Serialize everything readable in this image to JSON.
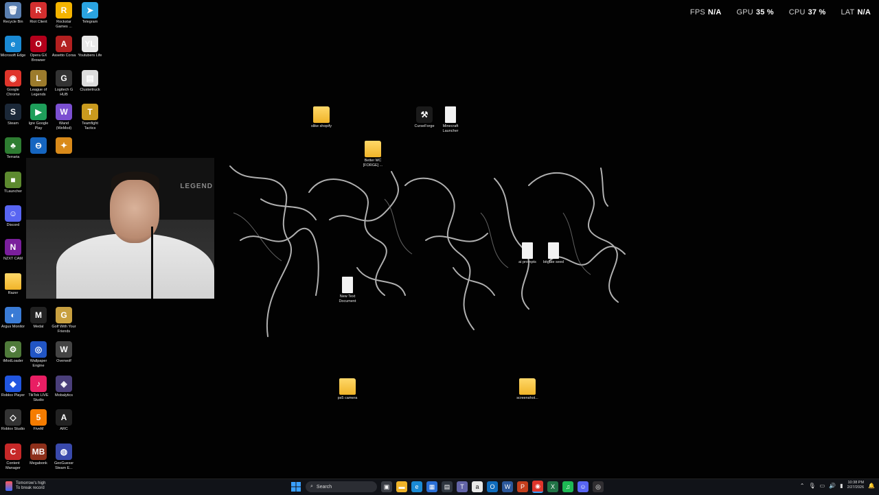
{
  "hud": {
    "fps_label": "FPS",
    "fps_value": "N/A",
    "gpu_label": "GPU",
    "gpu_value": "35 %",
    "cpu_label": "CPU",
    "cpu_value": "37 %",
    "lat_label": "LAT",
    "lat_value": "N/A"
  },
  "desktop_icons": [
    {
      "label": "Recycle Bin",
      "glyph": "🗑",
      "color": "#5a7fb0"
    },
    {
      "label": "Riot Client",
      "glyph": "R",
      "color": "#d32f2f"
    },
    {
      "label": "Rockstar Games ...",
      "glyph": "R",
      "color": "#f5b400"
    },
    {
      "label": "Telegram",
      "glyph": "➤",
      "color": "#2aa3e0"
    },
    {
      "label": "Microsoft Edge",
      "glyph": "e",
      "color": "#1a8ad4"
    },
    {
      "label": "Opera GX Browser",
      "glyph": "O",
      "color": "#b3001b"
    },
    {
      "label": "Assetto Corsa",
      "glyph": "A",
      "color": "#b32020"
    },
    {
      "label": "Youtubers Life",
      "glyph": "YL",
      "color": "#e8e8e8"
    },
    {
      "label": "Google Chrome",
      "glyph": "◉",
      "color": "#e0352b"
    },
    {
      "label": "League of Legends",
      "glyph": "L",
      "color": "#9c7b2c"
    },
    {
      "label": "Logitech G HUB",
      "glyph": "G",
      "color": "#333333"
    },
    {
      "label": "Clustertruck",
      "glyph": "▤",
      "color": "#dddddd"
    },
    {
      "label": "Steam",
      "glyph": "S",
      "color": "#1b2838"
    },
    {
      "label": "Igre Google Play",
      "glyph": "▶",
      "color": "#1e9e5a"
    },
    {
      "label": "Wand (WeMod)",
      "glyph": "W",
      "color": "#7b4fd1"
    },
    {
      "label": "Teamfight Tactics",
      "glyph": "T",
      "color": "#c99a1e"
    },
    {
      "label": "Terraria",
      "glyph": "♣",
      "color": "#2e7d32"
    },
    {
      "label": "",
      "glyph": "⊖",
      "color": "#1565c0"
    },
    {
      "label": "",
      "glyph": "✦",
      "color": "#d98a1a"
    },
    {
      "label": "TLauncher",
      "glyph": "■",
      "color": "#5d8a2f"
    },
    {
      "label": "Discord",
      "glyph": "☺",
      "color": "#5865f2"
    },
    {
      "label": "NZXT CAM",
      "glyph": "N",
      "color": "#7a1f9c"
    },
    {
      "label": "Razer",
      "glyph": "",
      "color": "#f0b429"
    },
    {
      "label": "Argus Monitor",
      "glyph": "◐",
      "color": "#3a7bd5"
    },
    {
      "label": "Medal",
      "glyph": "M",
      "color": "#222222"
    },
    {
      "label": "Golf With Your Friends",
      "glyph": "G",
      "color": "#c8a040"
    },
    {
      "label": "tModLoader",
      "glyph": "⚙",
      "color": "#4f7a3a"
    },
    {
      "label": "Wallpaper Engine",
      "glyph": "◎",
      "color": "#2155c4"
    },
    {
      "label": "Overwolf",
      "glyph": "W",
      "color": "#444444"
    },
    {
      "label": "Roblox Player",
      "glyph": "◆",
      "color": "#2156e0"
    },
    {
      "label": "TikTok LIVE Studio",
      "glyph": "♪",
      "color": "#e91e63"
    },
    {
      "label": "Mobalytics",
      "glyph": "◈",
      "color": "#4a3f7a"
    },
    {
      "label": "Roblox Studio",
      "glyph": "◇",
      "color": "#333333"
    },
    {
      "label": "FiveM",
      "glyph": "5",
      "color": "#f57c00"
    },
    {
      "label": "ARC",
      "glyph": "A",
      "color": "#222222"
    },
    {
      "label": "Content Manager",
      "glyph": "C",
      "color": "#c62828"
    },
    {
      "label": "Megabonk",
      "glyph": "MB",
      "color": "#8d2f1a"
    },
    {
      "label": "GeoGuessr Steam E...",
      "glyph": "◍",
      "color": "#3949ab"
    }
  ],
  "center_items": [
    {
      "label": "slike shopify",
      "kind": "folder"
    },
    {
      "label": "CurseForge",
      "kind": "app"
    },
    {
      "label": "Minecraft Launcher",
      "kind": "doc"
    },
    {
      "label": "Better MC [FORGE] ...",
      "kind": "folder"
    },
    {
      "label": "ai prompts",
      "kind": "doc"
    },
    {
      "label": "bitgate seed",
      "kind": "doc"
    },
    {
      "label": "New Text Document",
      "kind": "doc"
    },
    {
      "label": "ps5 camera",
      "kind": "folder"
    },
    {
      "label": "screenshot...",
      "kind": "folder"
    }
  ],
  "webcam": {
    "overlay_text": "LEGEND"
  },
  "taskbar": {
    "weather_title": "Tomorrow's high",
    "weather_sub": "To break record",
    "search_label": "Search",
    "time": "10:38 PM",
    "date": "2/27/2026"
  },
  "colors": {
    "accent": "#0a84ff",
    "desktop_bg": "#020202",
    "taskbar_bg": "#111318"
  }
}
